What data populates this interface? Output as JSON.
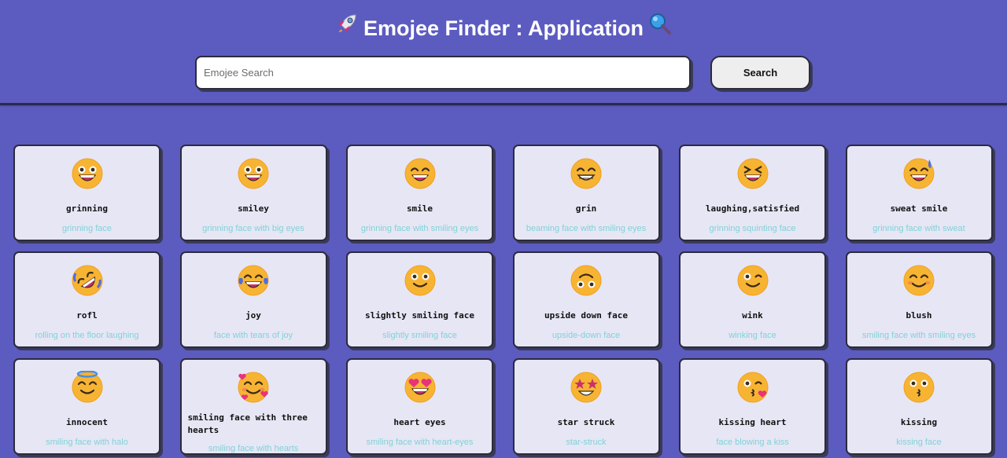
{
  "app": {
    "title": "Emojee Finder : Application",
    "title_left_icon": "rocket-icon",
    "title_right_icon": "magnifier-icon"
  },
  "search": {
    "placeholder": "Emojee Search",
    "value": "",
    "button_label": "Search"
  },
  "colors": {
    "background": "#5c5bc0",
    "card": "#e7e6f5",
    "desc_text": "#7fd3d6",
    "face": "#f7b433"
  },
  "cards": [
    {
      "name": "grinning",
      "desc": "grinning face",
      "icon": "grinning-face-icon"
    },
    {
      "name": "smiley",
      "desc": "grinning face with big eyes",
      "icon": "grinning-face-big-eyes-icon"
    },
    {
      "name": "smile",
      "desc": "grinning face with smiling eyes",
      "icon": "grinning-face-smiling-eyes-icon"
    },
    {
      "name": "grin",
      "desc": "beaming face with smiling eyes",
      "icon": "beaming-face-icon"
    },
    {
      "name": "laughing,satisfied",
      "desc": "grinning squinting face",
      "icon": "grinning-squinting-face-icon"
    },
    {
      "name": "sweat smile",
      "desc": "grinning face with sweat",
      "icon": "grinning-face-sweat-icon"
    },
    {
      "name": "rofl",
      "desc": "rolling on the floor laughing",
      "icon": "rolling-laughing-face-icon"
    },
    {
      "name": "joy",
      "desc": "face with tears of joy",
      "icon": "tears-of-joy-face-icon"
    },
    {
      "name": "slightly smiling face",
      "desc": "slightly smiling face",
      "icon": "slightly-smiling-face-icon"
    },
    {
      "name": "upside down face",
      "desc": "upside-down face",
      "icon": "upside-down-face-icon"
    },
    {
      "name": "wink",
      "desc": "winking face",
      "icon": "winking-face-icon"
    },
    {
      "name": "blush",
      "desc": "smiling face with smiling eyes",
      "icon": "blushing-face-icon"
    },
    {
      "name": "innocent",
      "desc": "smiling face with halo",
      "icon": "halo-face-icon"
    },
    {
      "name": "smiling face with three hearts",
      "desc": "smiling face with hearts",
      "icon": "three-hearts-face-icon"
    },
    {
      "name": "heart eyes",
      "desc": "smiling face with heart-eyes",
      "icon": "heart-eyes-face-icon"
    },
    {
      "name": "star struck",
      "desc": "star-struck",
      "icon": "star-struck-face-icon"
    },
    {
      "name": "kissing heart",
      "desc": "face blowing a kiss",
      "icon": "kissing-heart-face-icon"
    },
    {
      "name": "kissing",
      "desc": "kissing face",
      "icon": "kissing-face-icon"
    }
  ]
}
